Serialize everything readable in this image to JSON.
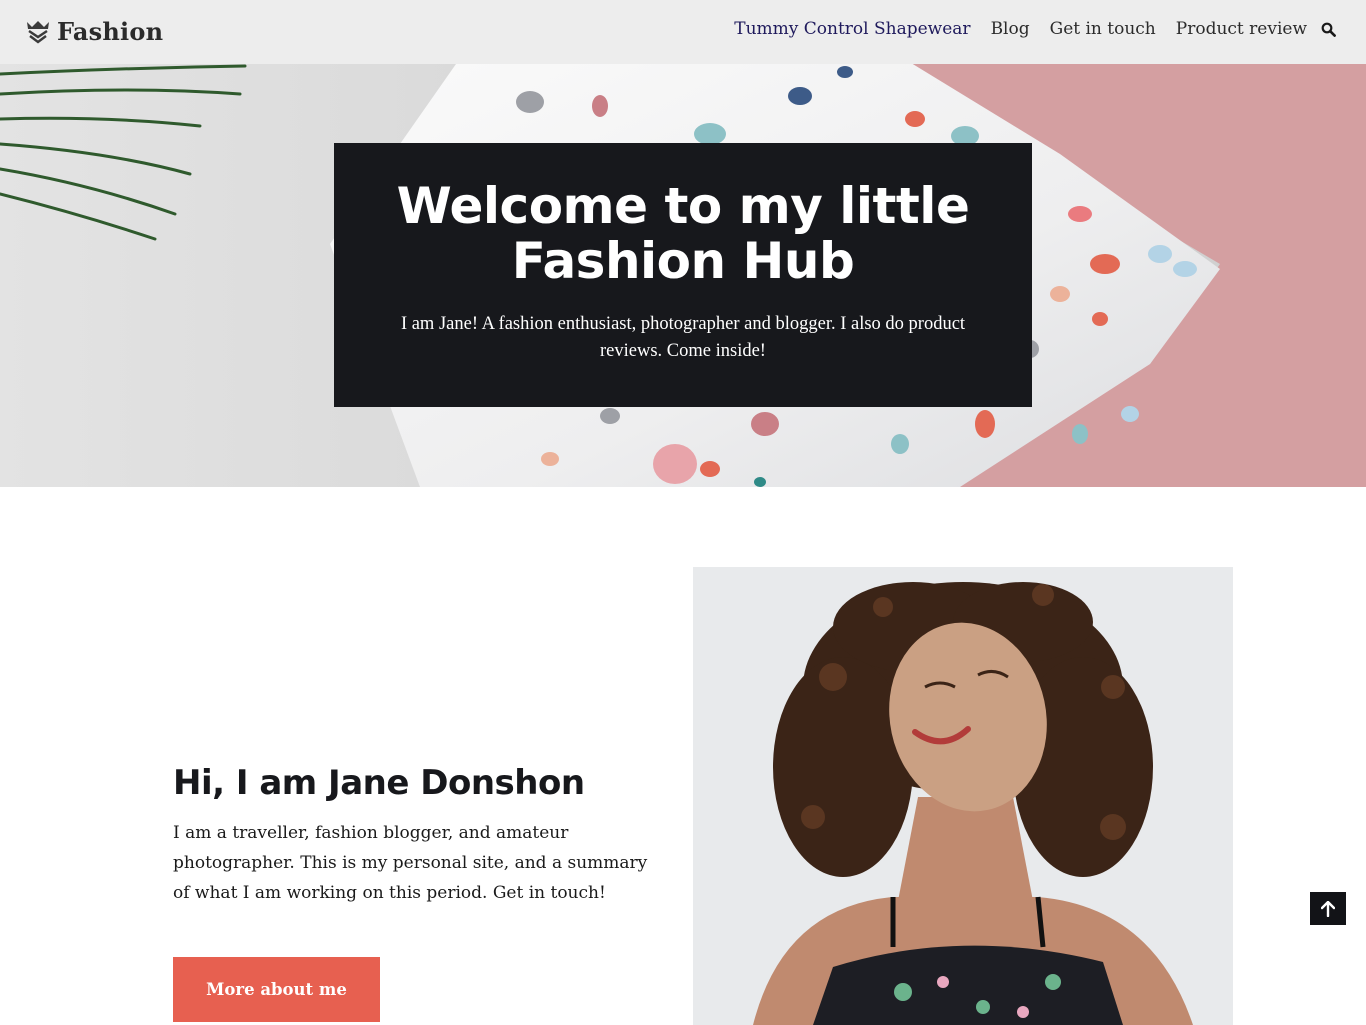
{
  "header": {
    "logo_text": "Fashion",
    "logo_icon": "crown-icon",
    "nav": [
      {
        "label": "Tummy Control Shapewear",
        "active": true
      },
      {
        "label": "Blog",
        "active": false
      },
      {
        "label": "Get in touch",
        "active": false
      },
      {
        "label": "Product review",
        "active": false
      }
    ],
    "search_icon": "search-icon"
  },
  "hero": {
    "title": "Welcome to my little Fashion Hub",
    "subtitle": "I am Jane! A fashion enthusiast, photographer and blogger. I also do product reviews. Come inside!",
    "background": "pillow-with-confetti-pattern-photo"
  },
  "about": {
    "title": "Hi, I am Jane Donshon",
    "text": "I am a traveller, fashion blogger, and amateur photographer. This is my personal site, and a summary of what I am working on this period. Get in touch!",
    "button_label": "More about me",
    "image": "portrait-of-smiling-woman-with-curly-hair"
  },
  "scroll_top_icon": "arrow-up-icon",
  "colors": {
    "header_bg": "#ededed",
    "hero_box_bg": "#17181c",
    "button_bg": "#e76050",
    "nav_active": "#1f1a5c",
    "hero_pink": "#d49fa1"
  }
}
